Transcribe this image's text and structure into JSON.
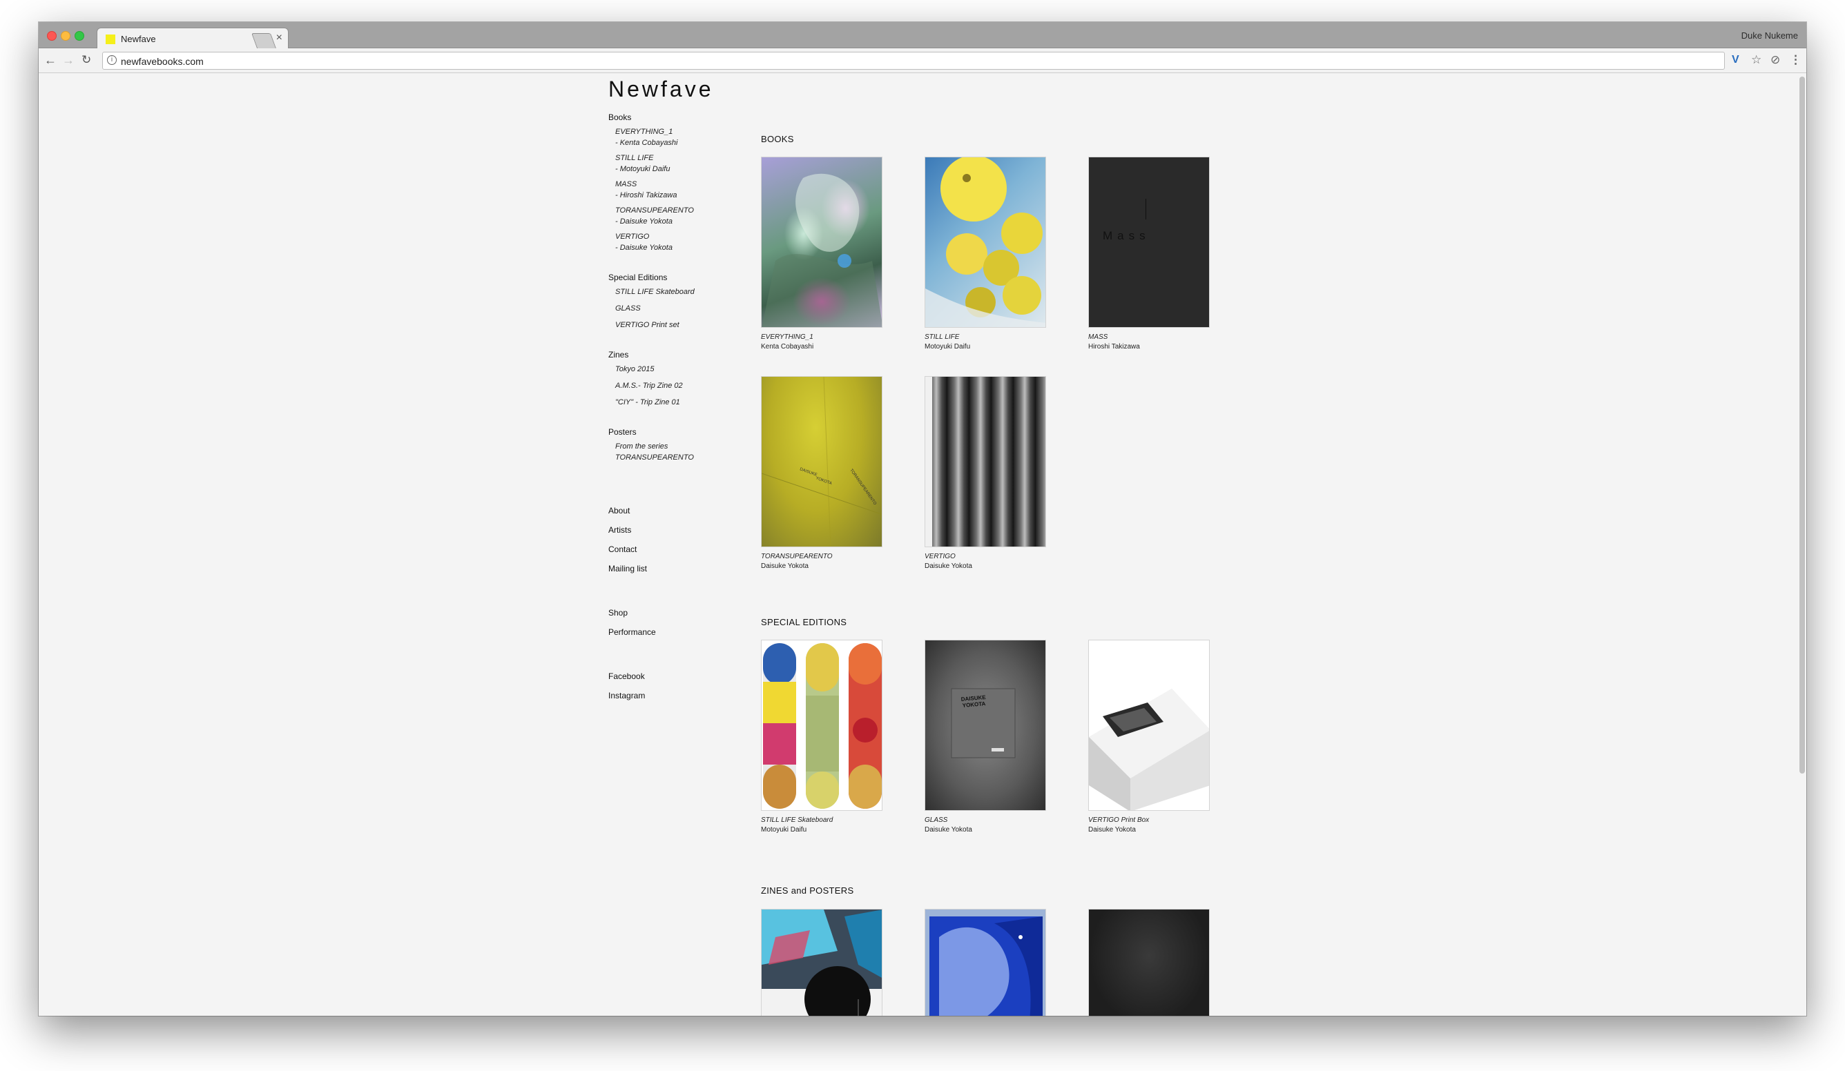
{
  "browser": {
    "tab_title": "Newfave",
    "tab_close": "×",
    "profile_name": "Duke Nukeme",
    "url": "newfavebooks.com",
    "back_icon": "←",
    "forward_icon": "→",
    "reload_icon": "↻",
    "info_icon": "i",
    "ext_v_icon": "V",
    "star_icon": "☆",
    "ext_icon": "⊘",
    "menu_icon": "⋮"
  },
  "site": {
    "logo": "Newfave",
    "nav": {
      "books_heading": "Books",
      "books": [
        {
          "title": "EVERYTHING_1",
          "author": "- Kenta Cobayashi"
        },
        {
          "title": "STILL LIFE",
          "author": "- Motoyuki Daifu"
        },
        {
          "title": "MASS",
          "author": "- Hiroshi Takizawa"
        },
        {
          "title": "TORANSUPEARENTO",
          "author": "- Daisuke Yokota"
        },
        {
          "title": "VERTIGO",
          "author": "- Daisuke Yokota"
        }
      ],
      "special_heading": "Special Editions",
      "special": [
        "STILL LIFE Skateboard",
        "GLASS",
        "VERTIGO Print set"
      ],
      "zines_heading": "Zines",
      "zines": [
        "Tokyo 2015",
        "A.M.S.- Trip Zine 02",
        "\"CIY\" - Trip Zine 01"
      ],
      "posters_heading": "Posters",
      "posters": [
        "From the series",
        "TORANSUPEARENTO"
      ],
      "info_links": [
        "About",
        "Artists",
        "Contact",
        "Mailing list"
      ],
      "shop_links": [
        "Shop",
        "Performance"
      ],
      "social_links": [
        "Facebook",
        "Instagram"
      ]
    },
    "sections": {
      "books": "BOOKS",
      "special": "SPECIAL EDITIONS",
      "zines": "ZINES and POSTERS"
    },
    "book_cards": [
      {
        "title": "EVERYTHING_1",
        "author": "Kenta Cobayashi"
      },
      {
        "title": "STILL LIFE",
        "author": "Motoyuki Daifu"
      },
      {
        "title": "MASS",
        "author": "Hiroshi Takizawa",
        "cover_text": "Mass"
      },
      {
        "title": "TORANSUPEARENTO",
        "author": "Daisuke Yokota"
      },
      {
        "title": "VERTIGO",
        "author": "Daisuke Yokota"
      }
    ],
    "special_cards": [
      {
        "title": "STILL LIFE Skateboard",
        "author": "Motoyuki Daifu"
      },
      {
        "title": "GLASS",
        "author": "Daisuke Yokota"
      },
      {
        "title": "VERTIGO Print Box",
        "author": "Daisuke Yokota"
      }
    ]
  }
}
